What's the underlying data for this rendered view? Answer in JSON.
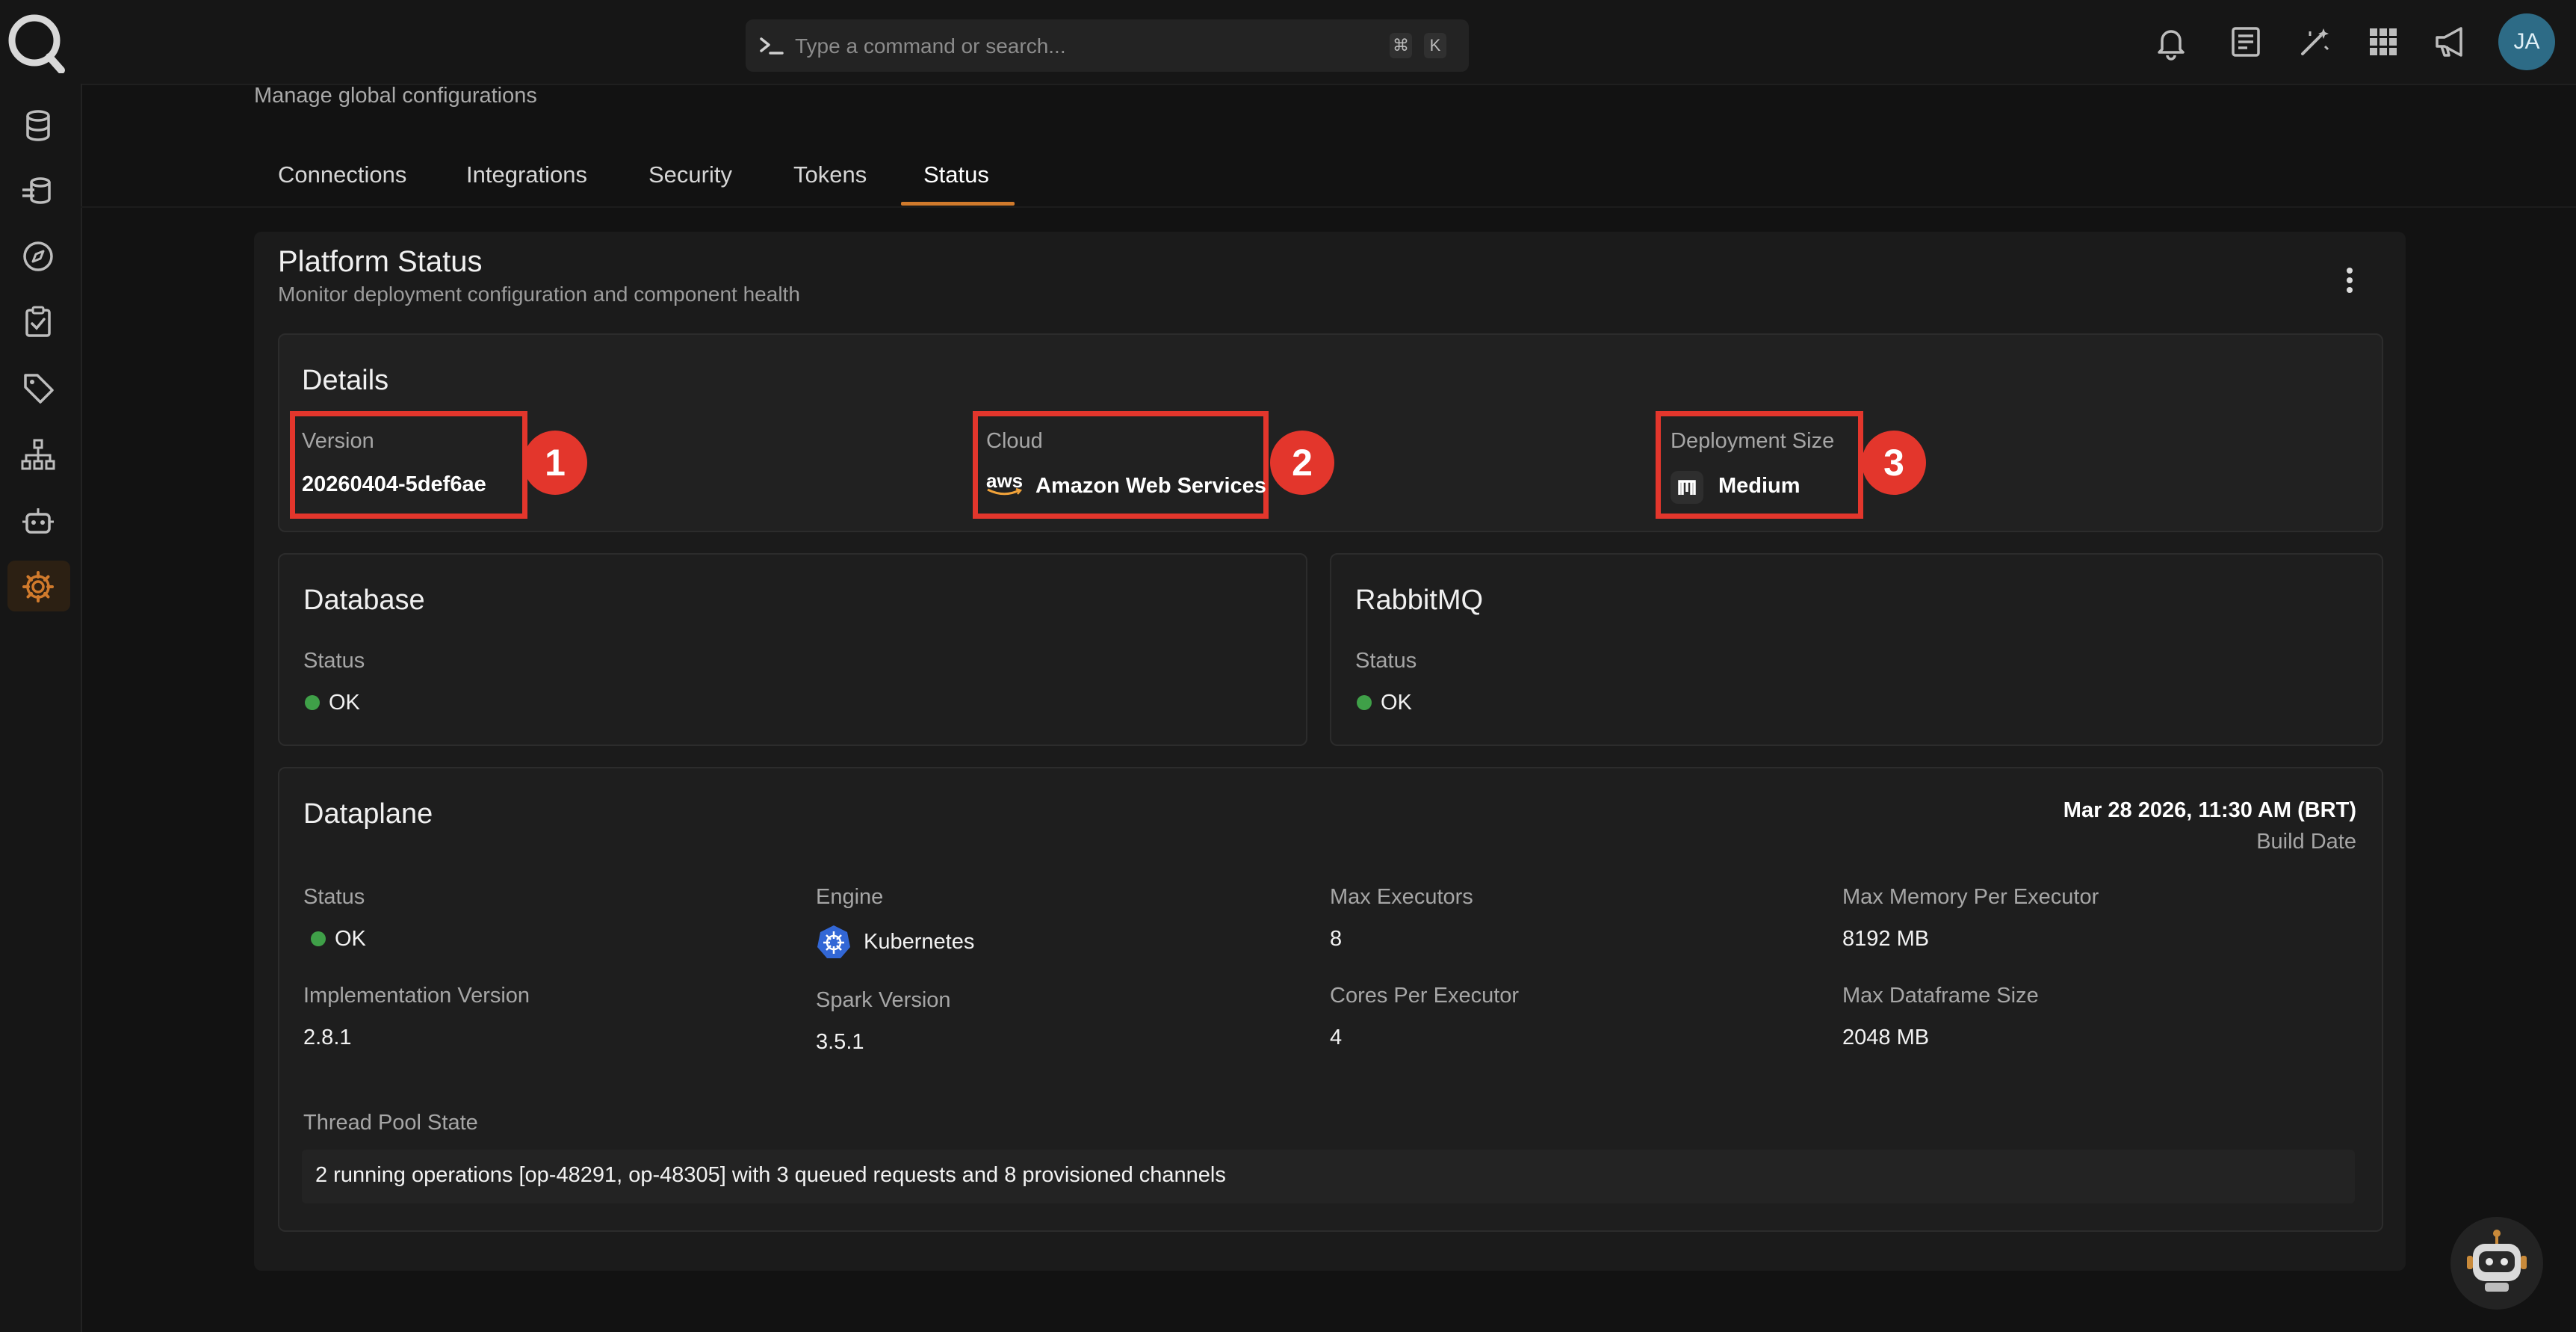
{
  "search": {
    "placeholder": "Type a command or search...",
    "shortcut_mod": "⌘",
    "shortcut_key": "K"
  },
  "user": {
    "initials": "JA"
  },
  "page": {
    "subtitle": "Manage global configurations"
  },
  "tabs": [
    {
      "label": "Connections"
    },
    {
      "label": "Integrations"
    },
    {
      "label": "Security"
    },
    {
      "label": "Tokens"
    },
    {
      "label": "Status",
      "active": true
    }
  ],
  "platform": {
    "title": "Platform Status",
    "subtitle": "Monitor deployment configuration and component health"
  },
  "details": {
    "title": "Details",
    "version": {
      "label": "Version",
      "value": "20260404-5def6ae"
    },
    "cloud": {
      "label": "Cloud",
      "logo_text": "aws",
      "value": "Amazon Web Services"
    },
    "size": {
      "label": "Deployment Size",
      "value": "Medium"
    }
  },
  "annotations": [
    "1",
    "2",
    "3"
  ],
  "database": {
    "title": "Database",
    "status_label": "Status",
    "status_value": "OK"
  },
  "rabbitmq": {
    "title": "RabbitMQ",
    "status_label": "Status",
    "status_value": "OK"
  },
  "dataplane": {
    "title": "Dataplane",
    "build_date": "Mar 28 2026, 11:30 AM (BRT)",
    "build_date_label": "Build Date",
    "status": {
      "label": "Status",
      "value": "OK"
    },
    "engine": {
      "label": "Engine",
      "value": "Kubernetes"
    },
    "max_executors": {
      "label": "Max Executors",
      "value": "8"
    },
    "max_memory": {
      "label": "Max Memory Per Executor",
      "value": "8192 MB"
    },
    "impl_version": {
      "label": "Implementation Version",
      "value": "2.8.1"
    },
    "spark_version": {
      "label": "Spark Version",
      "value": "3.5.1"
    },
    "cores": {
      "label": "Cores Per Executor",
      "value": "4"
    },
    "max_df": {
      "label": "Max Dataframe Size",
      "value": "2048 MB"
    },
    "thread_pool": {
      "label": "Thread Pool State",
      "value": "2 running operations [op-48291, op-48305] with 3 queued requests and 8 provisioned channels"
    }
  },
  "colors": {
    "accent": "#d07a2c",
    "ok": "#3fa048",
    "annotation": "#e3362c",
    "avatar": "#2d6b86"
  }
}
